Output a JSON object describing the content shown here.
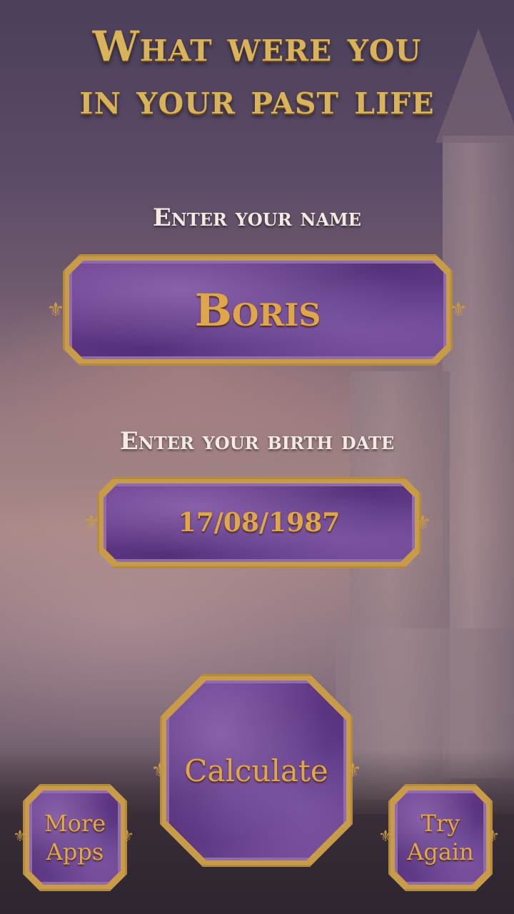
{
  "title": {
    "line1": "What were you",
    "line2": "in your past life"
  },
  "name_section": {
    "label": "Enter your name",
    "value": "Boris"
  },
  "date_section": {
    "label": "Enter your birth date",
    "value": "17/08/1987"
  },
  "buttons": {
    "calculate": "Calculate",
    "more_apps_line1": "More",
    "more_apps_line2": "Apps",
    "try_again_line1": "Try",
    "try_again_line2": "Again"
  },
  "icons": {
    "ornament": "fleur-de-lis-icon"
  },
  "colors": {
    "gold": "#d9b25c",
    "purple": "#5e3683",
    "label": "#f3ebe2"
  }
}
